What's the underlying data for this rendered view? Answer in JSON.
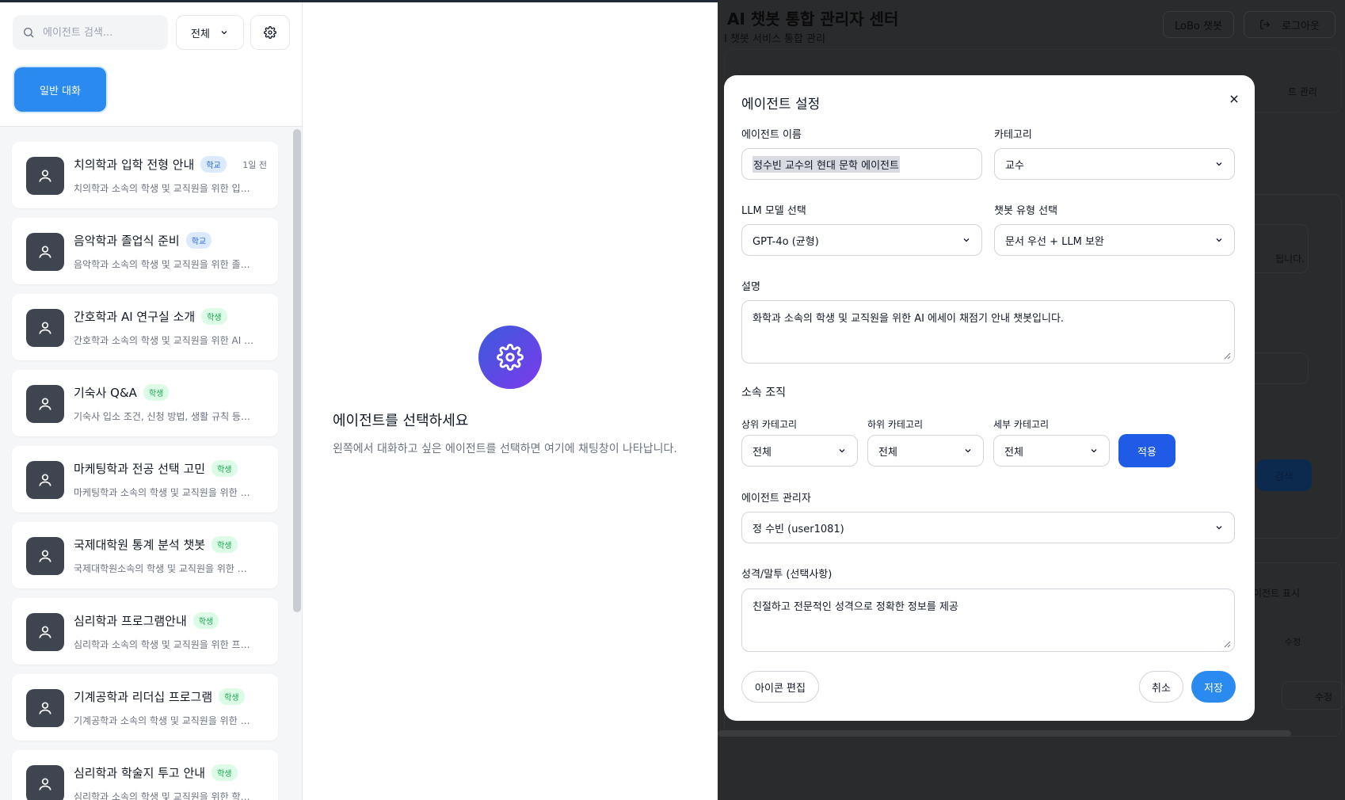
{
  "left": {
    "search": {
      "placeholder": "에이전트 검색..."
    },
    "filter": {
      "selected": "전체"
    },
    "general_chat_label": "일반 대화",
    "agents": [
      {
        "name": "치의학과 입학 전형 안내",
        "tag": "학교",
        "time": "1일 전",
        "desc": "치의학과 소속의 학생 및 교직원을 위한 입…"
      },
      {
        "name": "음악학과 졸업식 준비",
        "tag": "학교",
        "time": "",
        "desc": "음악학과 소속의 학생 및 교직원을 위한 졸…"
      },
      {
        "name": "간호학과 AI 연구실 소개",
        "tag": "학생",
        "time": "",
        "desc": "간호학과 소속의 학생 및 교직원을 위한 AI …"
      },
      {
        "name": "기숙사 Q&A",
        "tag": "학생",
        "time": "",
        "desc": "기숙사 입소 조건, 신청 방법, 생활 규칙 등…"
      },
      {
        "name": "마케팅학과 전공 선택 고민",
        "tag": "학생",
        "time": "",
        "desc": "마케팅학과 소속의 학생 및 교직원을 위한 …"
      },
      {
        "name": "국제대학원 통계 분석 챗봇",
        "tag": "학생",
        "time": "",
        "desc": "국제대학원소속의 학생 및 교직원을 위한 …"
      },
      {
        "name": "심리학과 프로그램안내",
        "tag": "학생",
        "time": "",
        "desc": "심리학과 소속의 학생 및 교직원을 위한 프…"
      },
      {
        "name": "기계공학과 리더십 프로그램",
        "tag": "학생",
        "time": "",
        "desc": "기계공학과 소속의 학생 및 교직원을 위한 …"
      },
      {
        "name": "심리학과 학술지 투고 안내",
        "tag": "학생",
        "time": "",
        "desc": "심리학과 소속의 학생 및 교직원을 위한 학…"
      }
    ],
    "empty_state": {
      "title": "에이전트를 선택하세요",
      "description": "왼쪽에서 대화하고 싶은 에이전트를 선택하면 여기에 채팅창이 나타납니다."
    }
  },
  "admin": {
    "title": "AI 챗봇 통합 관리자 센터",
    "subtitle": "I 챗봇 서비스 통합 관리",
    "lobo_label": "LoBo 챗봇",
    "logout_label": "로그아웃",
    "bg_texts": {
      "manage": "트 관리",
      "notice": "됩니다.",
      "search": "검색",
      "agent_display": "이전트 표시",
      "edit_col": "수정",
      "edit_btn": "수정"
    }
  },
  "modal": {
    "title": "에이전트 설정",
    "agent_name": {
      "label": "에이전트 이름",
      "value": "정수빈 교수의 현대 문학 에이전트"
    },
    "category": {
      "label": "카테고리",
      "value": "교수"
    },
    "llm_model": {
      "label": "LLM 모델 선택",
      "value": "GPT-4o (균형)"
    },
    "chatbot_type": {
      "label": "챗봇 유형 선택",
      "value": "문서 우선 + LLM 보완"
    },
    "description": {
      "label": "설명",
      "value": "화학과 소속의 학생 및 교직원을 위한 AI 에세이 채점기 안내 챗봇입니다."
    },
    "org": {
      "label": "소속 조직",
      "upper": {
        "label": "상위 카테고리",
        "value": "전체"
      },
      "lower": {
        "label": "하위 카테고리",
        "value": "전체"
      },
      "detail": {
        "label": "세부 카테고리",
        "value": "전체"
      },
      "apply_label": "적용"
    },
    "manager": {
      "label": "에이전트 관리자",
      "value": "정 수빈 (user1081)"
    },
    "personality": {
      "label": "성격/말투 (선택사항)",
      "value": "친절하고 전문적인 성격으로 정확한 정보를 제공"
    },
    "icon_edit_label": "아이콘 편집",
    "cancel_label": "취소",
    "save_label": "저장"
  },
  "colors": {
    "primary_blue": "#2b8af0",
    "apply_blue": "#1f5be6",
    "avatar_bg": "#3f4550",
    "tag_school_bg": "#dbeafe",
    "tag_student_bg": "#dcfce7"
  }
}
